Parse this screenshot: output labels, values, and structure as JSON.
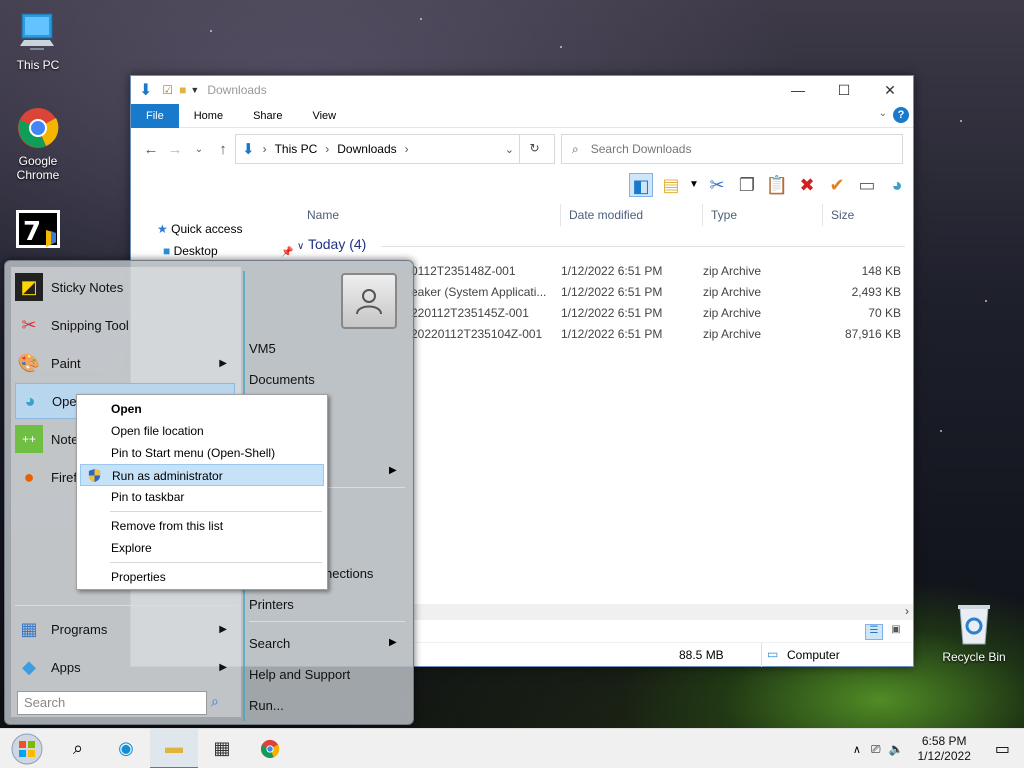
{
  "desktop": {
    "icons": [
      {
        "label": "This PC"
      },
      {
        "label": "Google Chrome"
      },
      {
        "label": ""
      },
      {
        "label": "Recycle Bin"
      }
    ]
  },
  "explorer": {
    "title": "Downloads",
    "tabs": [
      "File",
      "Home",
      "Share",
      "View"
    ],
    "address": {
      "crumb1": "This PC",
      "crumb2": "Downloads"
    },
    "search_placeholder": "Search Downloads",
    "nav": {
      "quick_access": "Quick access",
      "desktop": "Desktop"
    },
    "columns": {
      "name": "Name",
      "date": "Date modified",
      "type": "Type",
      "size": "Size"
    },
    "group_label": "Today (4)",
    "files": [
      {
        "name": "0112T235148Z-001",
        "date": "1/12/2022 6:51 PM",
        "type": "zip Archive",
        "size": "148 KB"
      },
      {
        "name": "eaker (System Applicati...",
        "date": "1/12/2022 6:51 PM",
        "type": "zip Archive",
        "size": "2,493 KB"
      },
      {
        "name": "220112T235145Z-001",
        "date": "1/12/2022 6:51 PM",
        "type": "zip Archive",
        "size": "70 KB"
      },
      {
        "name": "20220112T235104Z-001",
        "date": "1/12/2022 6:51 PM",
        "type": "zip Archive",
        "size": "87,916 KB"
      }
    ],
    "status": {
      "size": "88.5 MB",
      "location": "Computer"
    }
  },
  "start_menu": {
    "left_items": [
      {
        "label": "Sticky Notes"
      },
      {
        "label": "Snipping Tool"
      },
      {
        "label": "Paint"
      },
      {
        "label": "Ope"
      },
      {
        "label": "Note"
      },
      {
        "label": "Firef"
      }
    ],
    "programs": "Programs",
    "apps": "Apps",
    "search_placeholder": "Search",
    "right_items": {
      "user": "VM5",
      "documents": "Documents",
      "connections": "nections",
      "printers": "Printers",
      "search": "Search",
      "help": "Help and Support",
      "run": "Run..."
    }
  },
  "context_menu": {
    "items": [
      {
        "label": "Open"
      },
      {
        "label": "Open file location"
      },
      {
        "label": "Pin to Start menu (Open-Shell)"
      },
      {
        "label": "Run as administrator"
      },
      {
        "label": "Pin to taskbar"
      },
      {
        "label": "Remove from this list"
      },
      {
        "label": "Explore"
      },
      {
        "label": "Properties"
      }
    ]
  },
  "taskbar": {
    "time": "6:58 PM",
    "date": "1/12/2022"
  },
  "colors": {
    "accent": "#1979ca",
    "highlight": "#c5e2f8",
    "start_sep": "#38a6c7"
  }
}
